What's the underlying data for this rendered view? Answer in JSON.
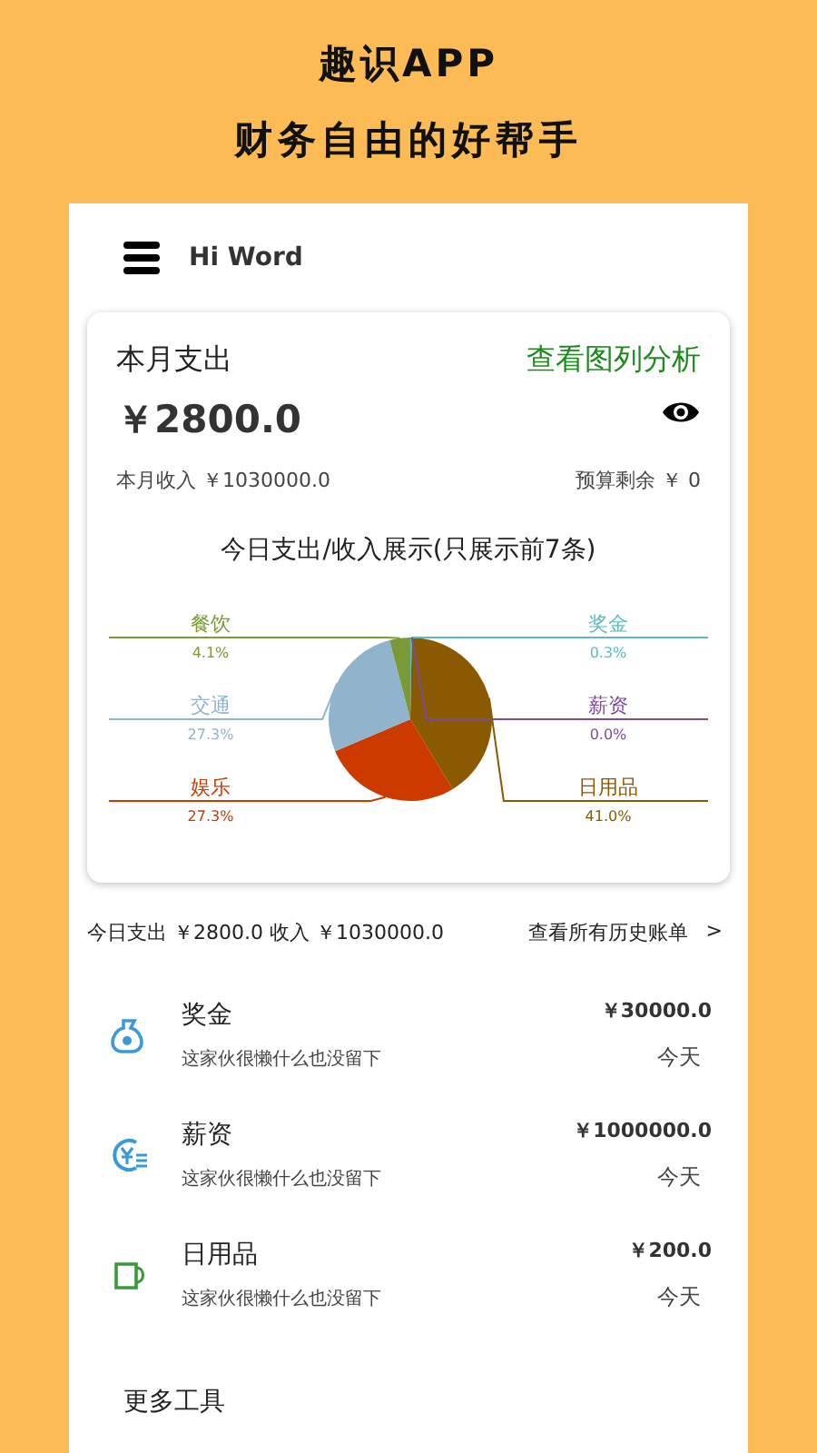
{
  "header": {
    "title": "趣识APP",
    "subtitle": "财务自由的好帮手"
  },
  "app_bar": {
    "title": "Hi Word"
  },
  "summary": {
    "label": "本月支出",
    "link": "查看图列分析",
    "amount": "￥2800.0",
    "income": "本月收入 ￥1030000.0",
    "budget": "预算剩余 ￥ 0"
  },
  "chart": {
    "chart_data": {
      "type": "pie",
      "title": "今日支出/收入展示(只展示前7条)",
      "categories": [
        "奖金",
        "薪资",
        "日用品",
        "娱乐",
        "交通",
        "餐饮"
      ],
      "values": [
        0.3,
        0.0,
        41.0,
        27.3,
        27.3,
        4.1
      ],
      "colors": [
        "#5bbcbc",
        "#7b4a9a",
        "#8a5a00",
        "#cc3a00",
        "#8fb4cc",
        "#7a9a3a"
      ],
      "value_labels": [
        "0.3%",
        "0.0%",
        "41.0%",
        "27.3%",
        "27.3%",
        "4.1%"
      ],
      "data_labels": true
    }
  },
  "today_bar": {
    "summary": "今日支出 ￥2800.0  收入 ￥1030000.0",
    "link": "查看所有历史账单",
    "chevron": ">"
  },
  "records": [
    {
      "kind": "bag",
      "title": "奖金",
      "note": "这家伙很懒什么也没留下",
      "amount": "￥30000.0",
      "date": "今天"
    },
    {
      "kind": "coin",
      "title": "薪资",
      "note": "这家伙很懒什么也没留下",
      "amount": "￥1000000.0",
      "date": "今天"
    },
    {
      "kind": "cup",
      "title": "日用品",
      "note": "这家伙很懒什么也没留下",
      "amount": "￥200.0",
      "date": "今天"
    }
  ],
  "footer": {
    "label": "更多工具"
  }
}
